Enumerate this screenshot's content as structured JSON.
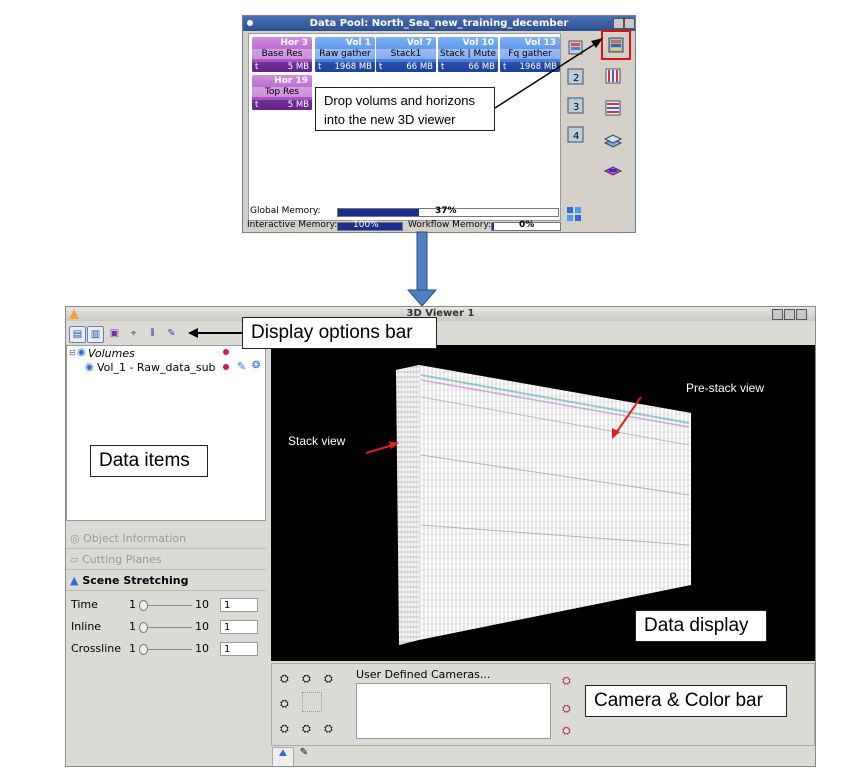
{
  "data_pool": {
    "title": "Data Pool: North_Sea_new_training_december",
    "items": [
      {
        "id": "Hor 3",
        "name": "Base Res",
        "unit": "t",
        "size": "5 MB",
        "kind": "horizon"
      },
      {
        "id": "Vol 1",
        "name": "Raw gather",
        "unit": "t",
        "size": "1968 MB",
        "kind": "volume"
      },
      {
        "id": "Vol 7",
        "name": "Stack1",
        "unit": "t",
        "size": "66 MB",
        "kind": "volume"
      },
      {
        "id": "Vol 10",
        "name": "Stack | Mute",
        "unit": "t",
        "size": "66 MB",
        "kind": "volume"
      },
      {
        "id": "Vol 13",
        "name": "Fq gather",
        "unit": "t",
        "size": "1968 MB",
        "kind": "volume"
      },
      {
        "id": "Hor 19",
        "name": "Top Res",
        "unit": "t",
        "size": "5 MB",
        "kind": "horizon"
      }
    ],
    "viewer_numbers": [
      "2",
      "3",
      "4"
    ],
    "global_memory_label": "Global Memory:",
    "global_memory_pct": "37%",
    "global_memory_value": 0.37,
    "interactive_memory_label": "Interactive Memory:",
    "interactive_memory_pct": "100%",
    "interactive_memory_value": 1.0,
    "workflow_memory_label": "Workflow Memory:",
    "workflow_memory_pct": "0%",
    "workflow_memory_value": 0.0
  },
  "callout": {
    "line1": "Drop volums and horizons",
    "line2": "into the new 3D viewer"
  },
  "viewer": {
    "title": "3D Viewer 1",
    "tree": {
      "root": "Volumes",
      "child": "Vol_1 - Raw_data_sub"
    },
    "panels": {
      "object_info": "Object Information",
      "cutting_planes": "Cutting Planes",
      "scene_stretching": "Scene Stretching"
    },
    "stretch_rows": [
      {
        "label": "Time",
        "min": "1",
        "max": "10",
        "value": "1"
      },
      {
        "label": "Inline",
        "min": "1",
        "max": "10",
        "value": "1"
      },
      {
        "label": "Crossline",
        "min": "1",
        "max": "10",
        "value": "1"
      }
    ],
    "user_cameras_label": "User Defined Cameras...",
    "stack_view_label": "Stack view",
    "prestack_view_label": "Pre-stack view"
  },
  "annotations": {
    "display_options_bar": "Display options bar",
    "data_items": "Data items",
    "data_display": "Data display",
    "camera_color_bar": "Camera & Color bar"
  },
  "colors": {
    "title_blue": "#2b4f93",
    "horizon_tile": "#b455d0",
    "volume_tile": "#3f7ee5",
    "memory_bar": "#1a2f8c",
    "arrow_red": "#e02020"
  }
}
